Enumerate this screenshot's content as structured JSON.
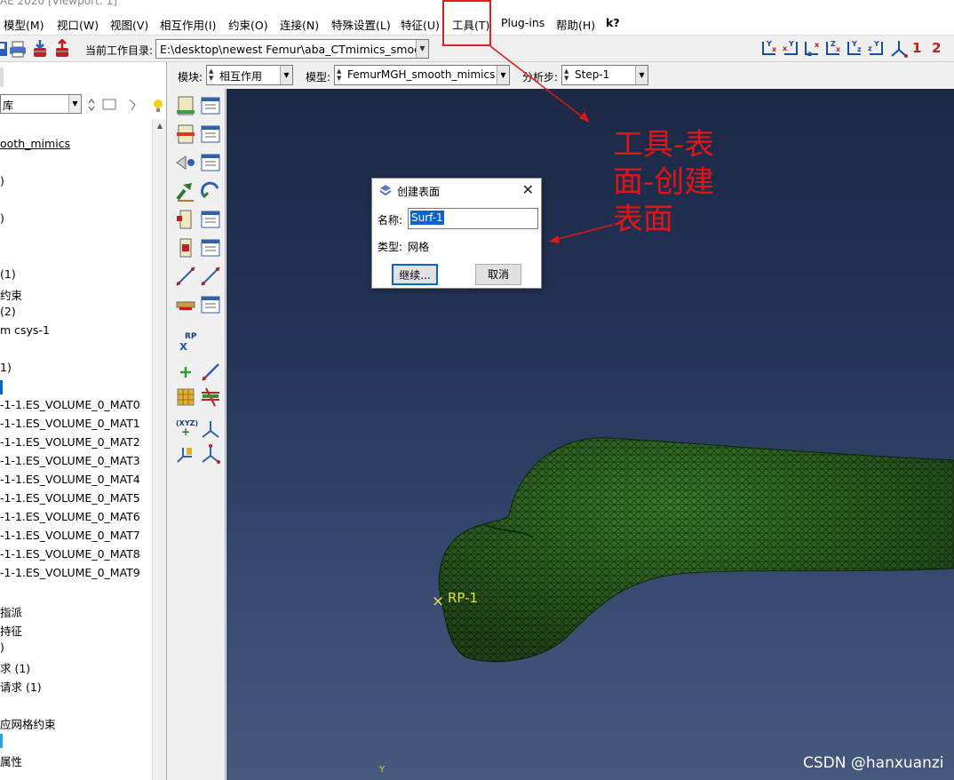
{
  "window": {
    "title": "AE 2020 [Viewport: 1]"
  },
  "menubar": {
    "items": [
      {
        "label": "模型(M)"
      },
      {
        "label": "视口(W)"
      },
      {
        "label": "视图(V)"
      },
      {
        "label": "相互作用(I)"
      },
      {
        "label": "约束(O)"
      },
      {
        "label": "连接(N)"
      },
      {
        "label": "特殊设置(L)"
      },
      {
        "label": "特征(U)"
      },
      {
        "label": "工具(T)"
      },
      {
        "label": "Plug-ins"
      },
      {
        "label": "帮助(H)"
      },
      {
        "label": "k?"
      }
    ]
  },
  "toolbar": {
    "workdir_label": "当前工作目录:",
    "workdir_value": "E:\\desktop\\newest Femur\\aba_CTmimics_smooth",
    "axis_icons": [
      "view-yx",
      "view-xy",
      "view-zx",
      "view-xz",
      "view-yz",
      "view-zy",
      "view-iso"
    ],
    "view_numbers": [
      "1",
      "2"
    ]
  },
  "context": {
    "module_label": "模块:",
    "module_value": "相互作用",
    "model_label": "模型:",
    "model_value": "FemurMGH_smooth_mimics",
    "step_label": "分析步:",
    "step_value": "Step-1"
  },
  "left_panel": {
    "filter_value": "库",
    "tree": [
      "ooth_mimics",
      ")",
      ")",
      "(1)",
      "约束",
      "(2)",
      "m csys-1",
      "1)",
      "-1-1.ES_VOLUME_0_MAT0",
      "-1-1.ES_VOLUME_0_MAT1",
      "-1-1.ES_VOLUME_0_MAT2",
      "-1-1.ES_VOLUME_0_MAT3",
      "-1-1.ES_VOLUME_0_MAT4",
      "-1-1.ES_VOLUME_0_MAT5",
      "-1-1.ES_VOLUME_0_MAT6",
      "-1-1.ES_VOLUME_0_MAT7",
      "-1-1.ES_VOLUME_0_MAT8",
      "-1-1.ES_VOLUME_0_MAT9",
      "指派",
      "持征",
      ")",
      "求 (1)",
      "请求 (1)",
      "应网格约束",
      "属性"
    ]
  },
  "toolbox": {
    "rp_label": "RP",
    "xyz_label": "(XYZ)"
  },
  "dialog": {
    "title": "创建表面",
    "name_label": "名称:",
    "name_value": "Surf-1",
    "type_label": "类型:",
    "type_value": "网格",
    "continue_label": "继续...",
    "cancel_label": "取消"
  },
  "viewport": {
    "rp_label": "RP-1",
    "axis_label": "Y",
    "mesh_color": "#3a7a2a"
  },
  "annotation": {
    "lines": [
      "工具-表",
      "面-创建",
      "表面"
    ],
    "color": "#e01515"
  },
  "watermark": "CSDN @hanxuanzi"
}
